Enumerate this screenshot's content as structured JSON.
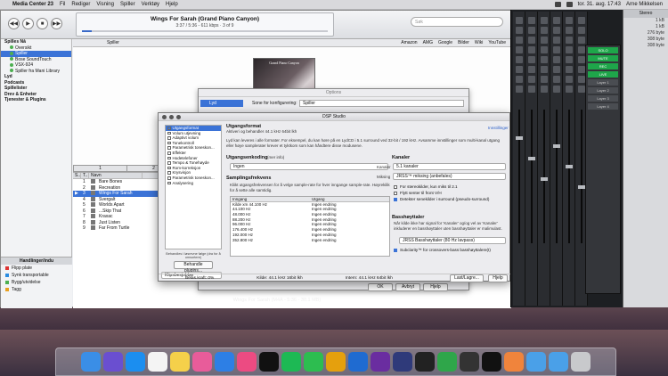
{
  "menubar": {
    "app": "Media Center 23",
    "items": [
      "Fil",
      "Rediger",
      "Visning",
      "Spiller",
      "Verktøy",
      "Hjelp"
    ],
    "clock": "tor. 31. aug.  17:43",
    "user": "Arne Mikkelsen"
  },
  "player": {
    "title": "Wings For Sarah (Grand Piano Canyon)",
    "status": "3:37 / 5:36 - 611 kbps  ·  3 of 9",
    "search_placeholder": "Søk"
  },
  "sidebar": {
    "header": "Spilles Nå",
    "items": [
      "Oversikt",
      "Spiller",
      "Bose SoundTouch",
      "VSX-924",
      "Spiller fra Mani Library"
    ],
    "sections": [
      "Lyd",
      "Podcasts",
      "Spillelister",
      "Drev & Enheter",
      "Tjenester & Plugins"
    ]
  },
  "toolbar": {
    "player_label": "Spiller",
    "links": [
      "Amazon",
      "AMG",
      "Google",
      "Bilder",
      "Wiki",
      "YouTube"
    ]
  },
  "cover": {
    "title": "Grand Piano Canyon"
  },
  "playlist": {
    "tabs": [
      "1",
      "2"
    ],
    "headers": [
      "S..",
      "T..",
      "Navn"
    ],
    "rows": [
      {
        "n": "1",
        "name": "Bare Bones"
      },
      {
        "n": "2",
        "name": "Recreation"
      },
      {
        "n": "3",
        "name": "Wings For Sarah"
      },
      {
        "n": "4",
        "name": "Svergalt"
      },
      {
        "n": "5",
        "name": "Worlds Apart"
      },
      {
        "n": "6",
        "name": "...Skip That"
      },
      {
        "n": "7",
        "name": "Kraxac"
      },
      {
        "n": "8",
        "name": "Just Listen"
      },
      {
        "n": "9",
        "name": "Far From Turtle"
      }
    ]
  },
  "tasks": {
    "header": "Handlinger/indu",
    "items": [
      "Flipp plate",
      "Synk transportable",
      "Bygg/utvidelse",
      "Tagg"
    ]
  },
  "options": {
    "title": "Options",
    "lyd": "Lyd",
    "cfg_label": "Sone for konfigurering:",
    "cfg_value": "Spiller",
    "ok": "OK",
    "cancel": "Avbryt",
    "help": "Hjelp"
  },
  "dsp": {
    "title": "DSP Studio",
    "modules": [
      {
        "label": "Utgangsformat",
        "on": true,
        "sel": true
      },
      {
        "label": "Volum utjevning",
        "on": false
      },
      {
        "label": "Adaptivt volum",
        "on": false
      },
      {
        "label": "Tonekontroll",
        "on": false
      },
      {
        "label": "Parametrisk toneskon...",
        "on": false
      },
      {
        "label": "Effekter",
        "on": false
      },
      {
        "label": "Hodetelefoner",
        "on": false
      },
      {
        "label": "Tempo & Tonehøyde",
        "on": false
      },
      {
        "label": "Rom-korreksjon",
        "on": false
      },
      {
        "label": "Krysvisjon",
        "on": false
      },
      {
        "label": "Parametrisk toneskon...",
        "on": false
      },
      {
        "label": "Analysering",
        "on": false
      }
    ],
    "hint": "Behandles i løsrevne følge (dra for å omsortere)",
    "load_plugin": "Behandle plugins...",
    "preset": "Klipsbesjobber",
    "section_title": "Utgangsformat",
    "active_info": "Aktiveri og behandler 44.1 kHz 64bit lkh",
    "settings_link": "Innstillinger",
    "description": "Lyd kan leveres i alle formater. For eksempel, du kan høre på en LydCD i 5.1 surround ved 32-bit / 192 kHz. Avsamme innstillinger som multi-kanal utgang eller høye samplerater krever et tyktkom som kan håndtere disse modusene.",
    "encoding_label": "Utgangsenkoding",
    "encoding_more": "(mer info)",
    "encoding_value": "Ingen",
    "samplerate_label": "Samplingsfrekvens",
    "samplerate_note": "Kliikt utgangsfrekvensen for å velge sample-rate for hver inngange sample-rate. Høyrekilik for å sette alle samtidig.",
    "rate_header": [
      "Inngang",
      "Utgang"
    ],
    "rates": [
      [
        "Kilde xm 44.100 Hz",
        "Ingen endring"
      ],
      [
        "44.100 Hz",
        "Ingen endring"
      ],
      [
        "48.000 Hz",
        "Ingen endring"
      ],
      [
        "88.200 Hz",
        "Ingen endring"
      ],
      [
        "96.000 Hz",
        "Ingen endring"
      ],
      [
        "176.400 Hz",
        "Ingen endring"
      ],
      [
        "192.000 Hz",
        "Ingen endring"
      ],
      [
        "352.800 Hz",
        "Ingen endring"
      ]
    ],
    "channels_label": "Kanaler",
    "channels_field": "Kanaler",
    "channels_value": "5.1 kanaler",
    "mixing_field": "Miksing",
    "mixing_value": "JRSS™ miksing (anbefales)",
    "ch_opts": [
      {
        "t": "For stereokilder, kun miks til 2.1",
        "on": false
      },
      {
        "t": "Flytt senter til front V/H",
        "on": false
      },
      {
        "t": "Detekter senekilder i surround (pseudo-surround)",
        "on": true
      }
    ],
    "bass_label": "Basshøyttaler",
    "bass_note": "Når kilde ikke har signal for 'Kanaler' og/og vel av 'Kanaler' inkluderer en basshøyttaler uten basshøyttaler er malimulast.",
    "bass_value": "JRSS Basshøyttaler (80 Hz lavpass)",
    "bass_opt": "Subclarity™ for crossovers-bass basshøyttalere(t)",
    "status_left": "Belas.kraft: 0%",
    "status_mid": "Kilde: 44.1 kHz 16bit lkh",
    "status_right": "Intern: 44.1 kHz 64bit lkh",
    "load_save": "Last/Lagre...",
    "help": "Hjelp"
  },
  "mixer": {
    "panel": [
      "SOLO",
      "MUTE",
      "REC",
      "LIVE",
      "Layer 1",
      "Layer 2",
      "Layer 3",
      "Layer 4"
    ],
    "right_title": "Stereo",
    "right_vals": [
      "1 kB",
      "1 kB",
      "276 byte",
      "308 byte",
      "308 byte"
    ]
  },
  "now_playing_bottom": "Wings For Sarah (M4A - 5:36 - 30.1 MB)",
  "dock": {
    "apps": [
      "Finder",
      "Siri",
      "App Store",
      "Kalender",
      "Notater",
      "Bilder",
      "Safari",
      "iTunes",
      "TIDAL",
      "Spotify",
      "Evernote",
      "Plex",
      "Dashboard",
      "dsp",
      "REW",
      "Mixer",
      "uTorrent",
      "TotalMix",
      "Sonos",
      "Photos",
      "Mappe",
      "Mappe",
      "Papirkurv"
    ],
    "colors": [
      "#3a8ee6",
      "#6a4fd0",
      "#1b8ef0",
      "#f4f4f4",
      "#f5d04a",
      "#e85c9a",
      "#2d7fe5",
      "#ec4b82",
      "#111",
      "#1db954",
      "#2dbd50",
      "#e5a00d",
      "#1f6bd1",
      "#6a2da0",
      "#2f3a7a",
      "#222",
      "#2fa64a",
      "#333",
      "#111",
      "#f0843c",
      "#4aa0e8",
      "#4aa0e8",
      "#c8c9cc"
    ]
  }
}
